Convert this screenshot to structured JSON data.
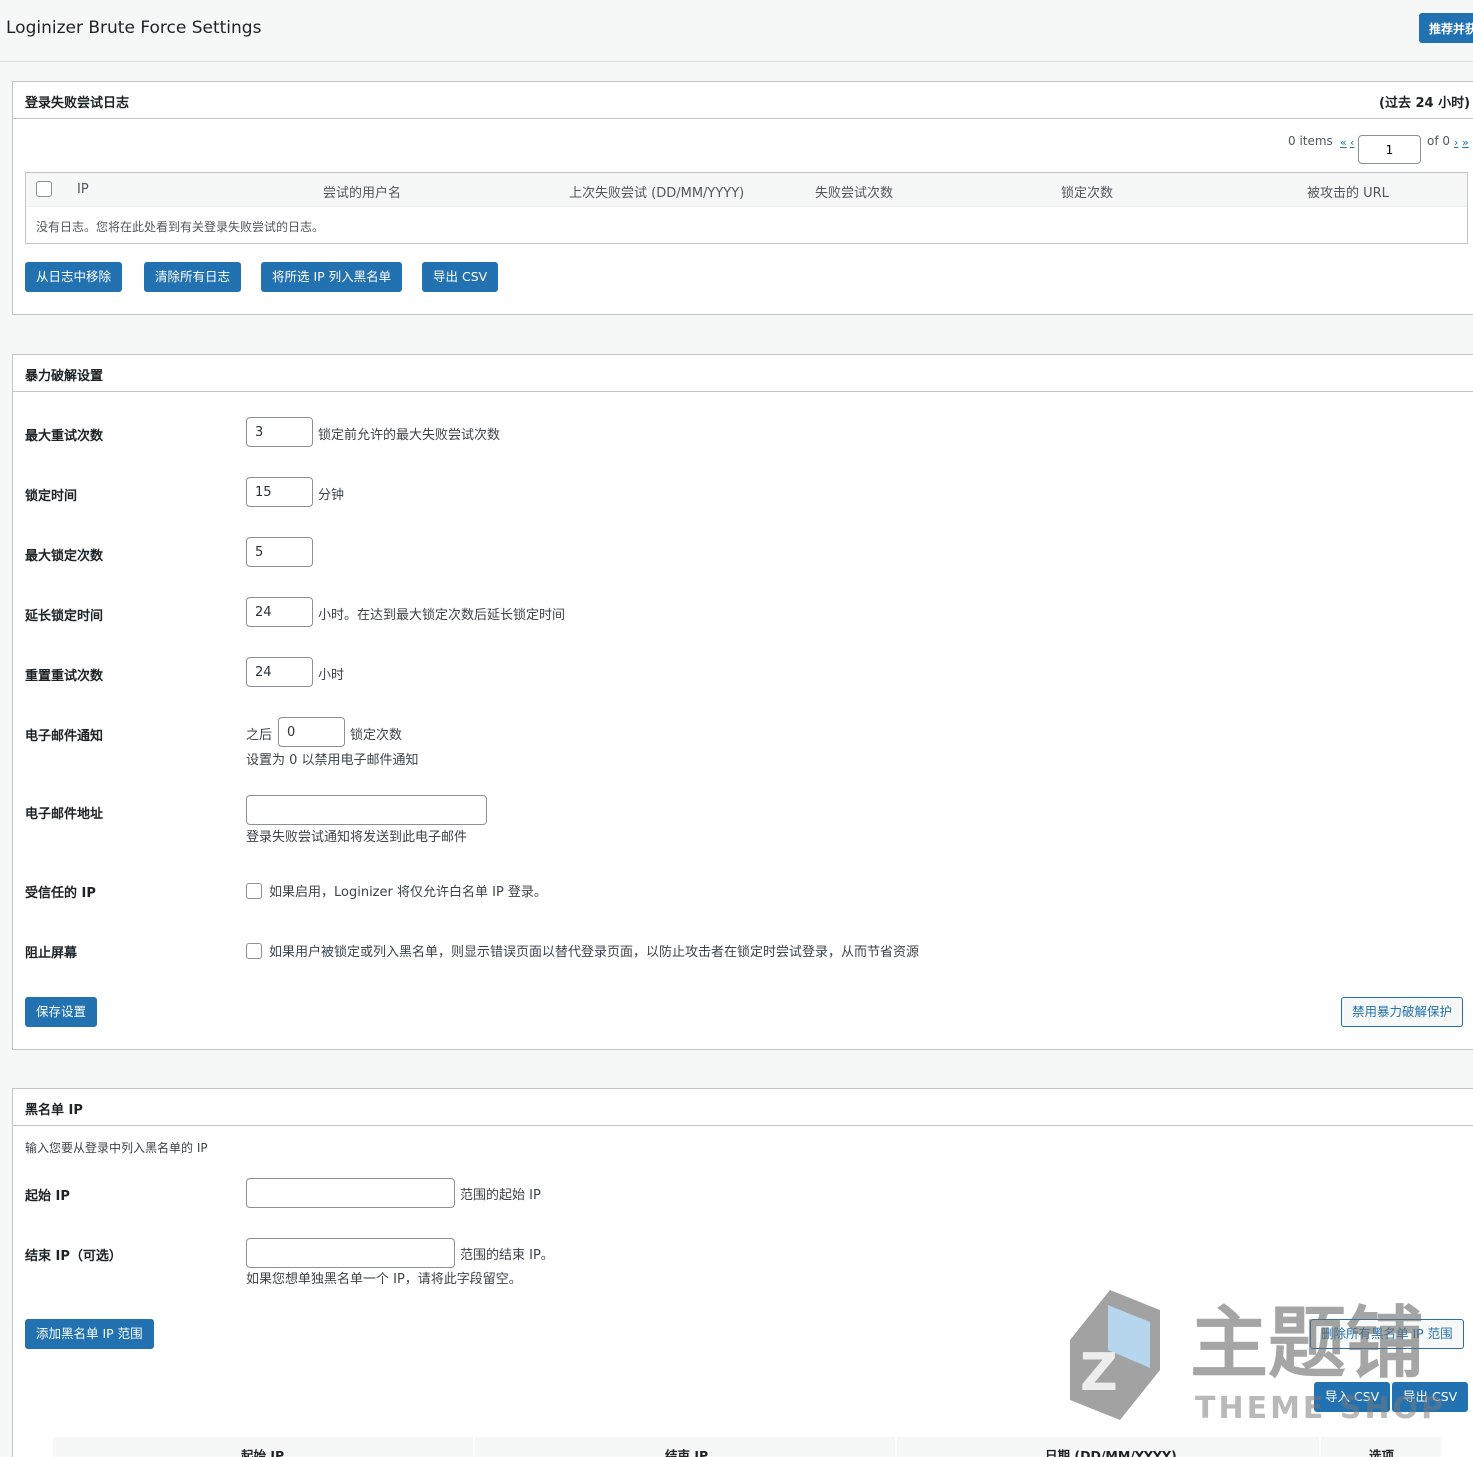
{
  "page": {
    "title": "Loginizer Brute Force Settings",
    "recommend_label": "推荐并获"
  },
  "failed_log": {
    "title": "登录失败尝试日志",
    "period": "(过去 24 小时)",
    "pager": {
      "items": "0 items",
      "first": "«",
      "prev": "‹",
      "current_page": "1",
      "of_total": "of 0",
      "next": "›",
      "last": "»"
    },
    "columns": [
      "IP",
      "尝试的用户名",
      "上次失败尝试 (DD/MM/YYYY)",
      "失败尝试次数",
      "锁定次数",
      "被攻击的 URL"
    ],
    "empty_text": "没有日志。您将在此处看到有关登录失败尝试的日志。",
    "actions": {
      "remove": "从日志中移除",
      "clear": "清除所有日志",
      "blacklist": "将所选 IP 列入黑名单",
      "export": "导出 CSV"
    }
  },
  "brute_force": {
    "title": "暴力破解设置",
    "max_retries": {
      "label": "最大重试次数",
      "value": "3",
      "hint": "锁定前允许的最大失败尝试次数"
    },
    "lockout_time": {
      "label": "锁定时间",
      "value": "15",
      "hint": "分钟"
    },
    "max_lockouts": {
      "label": "最大锁定次数",
      "value": "5"
    },
    "extend_lockout": {
      "label": "延长锁定时间",
      "value": "24",
      "hint": "小时。在达到最大锁定次数后延长锁定时间"
    },
    "reset_retries": {
      "label": "重置重试次数",
      "value": "24",
      "hint": "小时"
    },
    "email_notify": {
      "label": "电子邮件通知",
      "prefix": "之后",
      "value": "0",
      "suffix": "锁定次数",
      "hint": "设置为 0 以禁用电子邮件通知"
    },
    "email_address": {
      "label": "电子邮件地址",
      "value": "",
      "hint": "登录失败尝试通知将发送到此电子邮件"
    },
    "trusted_ip": {
      "label": "受信任的 IP",
      "hint": "如果启用，Loginizer 将仅允许白名单 IP 登录。"
    },
    "block_screen": {
      "label": "阻止屏幕",
      "hint": "如果用户被锁定或列入黑名单，则显示错误页面以替代登录页面，以防止攻击者在锁定时尝试登录，从而节省资源"
    },
    "save_label": "保存设置",
    "disable_label": "禁用暴力破解保护"
  },
  "blacklist": {
    "title": "黑名单 IP",
    "intro": "输入您要从登录中列入黑名单的 IP",
    "start_ip": {
      "label": "起始 IP",
      "value": "",
      "hint": "范围的起始 IP"
    },
    "end_ip": {
      "label": "结束 IP（可选）",
      "value": "",
      "hint": "范围的结束 IP。",
      "note": "如果您想单独黑名单一个 IP，请将此字段留空。"
    },
    "add_label": "添加黑名单 IP 范围",
    "delete_all_label": "删除所有黑名单 IP 范围",
    "import_label": "导入 CSV",
    "export_label": "导出 CSV",
    "columns": [
      "起始 IP",
      "结束 IP",
      "日期 (DD/MM/YYYY)",
      "选项"
    ]
  },
  "watermark": {
    "cn": "主题铺",
    "en": "THEME SHOP"
  },
  "colors": {
    "primary": "#2271b1",
    "border": "#c3c4c7",
    "background": "#f6f7f7"
  }
}
